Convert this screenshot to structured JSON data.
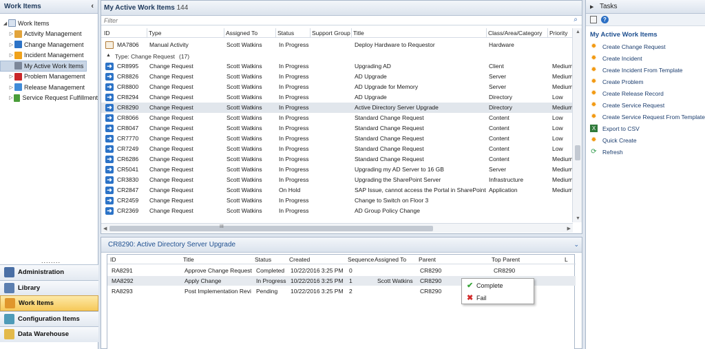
{
  "nav": {
    "title": "Work Items",
    "collapse_icon": "chevron-left-icon",
    "tree": [
      {
        "label": "Work Items",
        "level": 0,
        "expanded": true
      },
      {
        "label": "Activity Management",
        "level": 1,
        "color": "#e2a43b"
      },
      {
        "label": "Change Management",
        "level": 1,
        "color": "#2c73c7"
      },
      {
        "label": "Incident Management",
        "level": 1,
        "color": "#f0a21a"
      },
      {
        "label": "My Active Work Items",
        "level": 1,
        "color": "#7c8799",
        "selected": true
      },
      {
        "label": "Problem Management",
        "level": 1,
        "color": "#c9262a"
      },
      {
        "label": "Release Management",
        "level": 1,
        "color": "#3f8bd8"
      },
      {
        "label": "Service Request Fulfillment",
        "level": 1,
        "color": "#4a9d3a"
      }
    ],
    "dots": "........",
    "wunderbar": [
      {
        "label": "Administration",
        "icon": "admin-icon",
        "color": "#4a6fa5"
      },
      {
        "label": "Library",
        "icon": "library-icon",
        "color": "#5c7fb0"
      },
      {
        "label": "Work Items",
        "icon": "work-items-icon",
        "color": "#e0962c",
        "active": true
      },
      {
        "label": "Configuration Items",
        "icon": "config-items-icon",
        "color": "#4e9bb8"
      },
      {
        "label": "Data Warehouse",
        "icon": "data-warehouse-icon",
        "color": "#e3b94a"
      }
    ]
  },
  "grid": {
    "title": "My Active Work Items",
    "count": "144",
    "filter_placeholder": "Filter",
    "columns": [
      "ID",
      "Type",
      "Assigned To",
      "Status",
      "Support Group",
      "Title",
      "Class/Area/Category",
      "Priority"
    ],
    "top_row": {
      "id": "MA7806",
      "type": "Manual Activity",
      "assigned": "Scott Watkins",
      "status": "In Progress",
      "title": "Deploy Hardware to Requestor",
      "class": "Hardware",
      "priority": ""
    },
    "group_label": "Type: Change Request",
    "group_count": "(17)",
    "rows": [
      {
        "id": "CR8995",
        "type": "Change Request",
        "assigned": "Scott Watkins",
        "status": "In Progress",
        "title": "Upgrading AD",
        "class": "Client",
        "priority": "Medium"
      },
      {
        "id": "CR8826",
        "type": "Change Request",
        "assigned": "Scott Watkins",
        "status": "In Progress",
        "title": "AD Upgrade",
        "class": "Server",
        "priority": "Medium"
      },
      {
        "id": "CR8800",
        "type": "Change Request",
        "assigned": "Scott Watkins",
        "status": "In Progress",
        "title": "AD Upgrade for Memory",
        "class": "Server",
        "priority": "Medium"
      },
      {
        "id": "CR8294",
        "type": "Change Request",
        "assigned": "Scott Watkins",
        "status": "In Progress",
        "title": "AD Upgrade",
        "class": "Directory",
        "priority": "Low"
      },
      {
        "id": "CR8290",
        "type": "Change Request",
        "assigned": "Scott Watkins",
        "status": "In Progress",
        "title": "Active Directory Server Upgrade",
        "class": "Directory",
        "priority": "Medium",
        "selected": true
      },
      {
        "id": "CR8066",
        "type": "Change Request",
        "assigned": "Scott Watkins",
        "status": "In Progress",
        "title": "Standard Change Request",
        "class": "Content",
        "priority": "Low"
      },
      {
        "id": "CR8047",
        "type": "Change Request",
        "assigned": "Scott Watkins",
        "status": "In Progress",
        "title": "Standard Change Request",
        "class": "Content",
        "priority": "Low"
      },
      {
        "id": "CR7770",
        "type": "Change Request",
        "assigned": "Scott Watkins",
        "status": "In Progress",
        "title": "Standard Change Request",
        "class": "Content",
        "priority": "Low"
      },
      {
        "id": "CR7249",
        "type": "Change Request",
        "assigned": "Scott Watkins",
        "status": "In Progress",
        "title": "Standard Change Request",
        "class": "Content",
        "priority": "Low"
      },
      {
        "id": "CR6286",
        "type": "Change Request",
        "assigned": "Scott Watkins",
        "status": "In Progress",
        "title": "Standard Change Request",
        "class": "Content",
        "priority": "Medium"
      },
      {
        "id": "CR5041",
        "type": "Change Request",
        "assigned": "Scott Watkins",
        "status": "In Progress",
        "title": "Upgrading my AD Server to 16 GB",
        "class": "Server",
        "priority": "Medium"
      },
      {
        "id": "CR3830",
        "type": "Change Request",
        "assigned": "Scott Watkins",
        "status": "In Progress",
        "title": "Upgrading the SharePoint Server",
        "class": "Infrastructure",
        "priority": "Medium"
      },
      {
        "id": "CR2847",
        "type": "Change Request",
        "assigned": "Scott Watkins",
        "status": "On Hold",
        "title": "SAP Issue, cannot access the Portal in SharePoint",
        "class": "Application",
        "priority": "Medium"
      },
      {
        "id": "CR2459",
        "type": "Change Request",
        "assigned": "Scott Watkins",
        "status": "In Progress",
        "title": "Change to Switch on Floor 3",
        "class": "",
        "priority": ""
      },
      {
        "id": "CR2369",
        "type": "Change Request",
        "assigned": "Scott Watkins",
        "status": "In Progress",
        "title": "AD Group Policy Change",
        "class": "",
        "priority": ""
      }
    ],
    "hscroll_grip": "III"
  },
  "detail": {
    "title": "CR8290: Active Directory Server Upgrade",
    "columns": [
      "ID",
      "Title",
      "Status",
      "Created",
      "Sequence",
      "Assigned To",
      "Parent",
      "Top Parent",
      "L"
    ],
    "rows": [
      {
        "id": "RA8291",
        "title": "Approve Change Request",
        "status": "Completed",
        "created": "10/22/2016 3:25 PM",
        "seq": "0",
        "assigned": "",
        "parent": "CR8290",
        "top": "CR8290"
      },
      {
        "id": "MA8292",
        "title": "Apply Change",
        "status": "In Progress",
        "created": "10/22/2016 3:25 PM",
        "seq": "1",
        "assigned": "Scott Watkins",
        "parent": "CR8290",
        "top": "CR8290",
        "selected": true
      },
      {
        "id": "RA8293",
        "title": "Post Implementation Revi",
        "status": "Pending",
        "created": "10/22/2016 3:25 PM",
        "seq": "2",
        "assigned": "",
        "parent": "CR8290",
        "top": ""
      }
    ]
  },
  "context_menu": {
    "items": [
      {
        "label": "Complete",
        "icon": "check-icon",
        "color": "#3aa53a"
      },
      {
        "label": "Fail",
        "icon": "x-icon",
        "color": "#d22b2b"
      }
    ]
  },
  "tasks": {
    "title": "Tasks",
    "section": "My Active Work Items",
    "items": [
      {
        "label": "Create Change Request",
        "icon": "sun-icon"
      },
      {
        "label": "Create Incident",
        "icon": "sun-icon"
      },
      {
        "label": "Create Incident From Template",
        "icon": "sun-icon"
      },
      {
        "label": "Create Problem",
        "icon": "sun-icon"
      },
      {
        "label": "Create Release Record",
        "icon": "sun-icon"
      },
      {
        "label": "Create Service Request",
        "icon": "sun-icon"
      },
      {
        "label": "Create Service Request From Template",
        "icon": "sun-icon"
      },
      {
        "label": "Export to CSV",
        "icon": "excel-icon"
      },
      {
        "label": "Quick Create",
        "icon": "sun-icon"
      },
      {
        "label": "Refresh",
        "icon": "refresh-icon"
      }
    ]
  }
}
